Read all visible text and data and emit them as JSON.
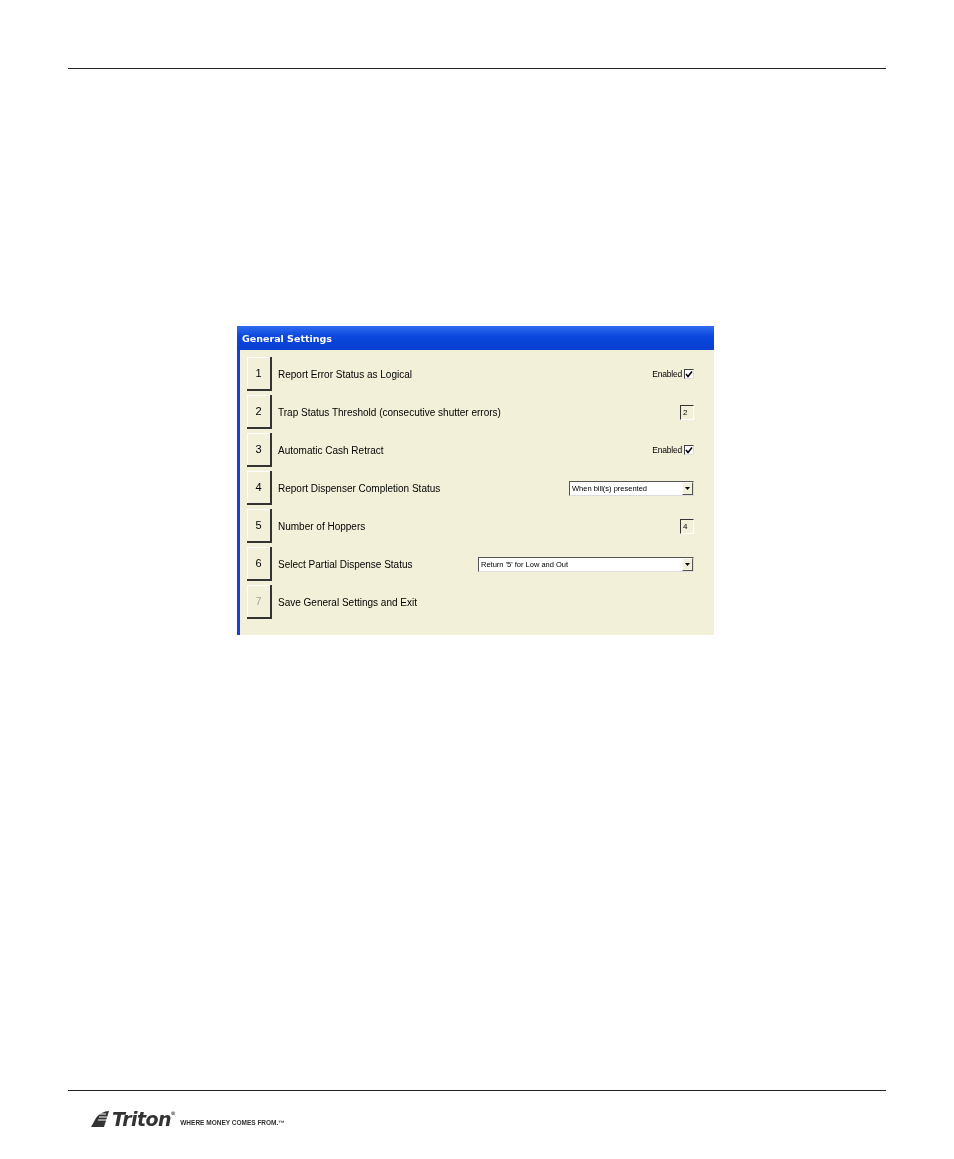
{
  "window": {
    "title": "General Settings"
  },
  "settings": [
    {
      "number": "1",
      "label": "Report Error Status as Logical",
      "disabled": false,
      "kind": "checkbox",
      "control": {
        "label": "Enabled",
        "checked": true
      }
    },
    {
      "number": "2",
      "label": "Trap Status Threshold (consecutive shutter errors)",
      "disabled": false,
      "kind": "number",
      "control": {
        "value": "2"
      }
    },
    {
      "number": "3",
      "label": "Automatic Cash Retract",
      "disabled": false,
      "kind": "checkbox",
      "control": {
        "label": "Enabled",
        "checked": true
      }
    },
    {
      "number": "4",
      "label": "Report Dispenser Completion Status",
      "disabled": false,
      "kind": "dropdown",
      "control": {
        "value": "When bill(s) presented",
        "wide": false
      }
    },
    {
      "number": "5",
      "label": "Number of Hoppers",
      "disabled": false,
      "kind": "number",
      "control": {
        "value": "4"
      }
    },
    {
      "number": "6",
      "label": "Select Partial Dispense Status",
      "disabled": false,
      "kind": "dropdown",
      "control": {
        "value": "Return '5' for Low and Out",
        "wide": true
      }
    },
    {
      "number": "7",
      "label": "Save General Settings and Exit",
      "disabled": true,
      "kind": "action"
    }
  ],
  "footer": {
    "brand": "Triton$^{®}$",
    "tagline": "WHERE MONEY COMES FROM.™"
  }
}
